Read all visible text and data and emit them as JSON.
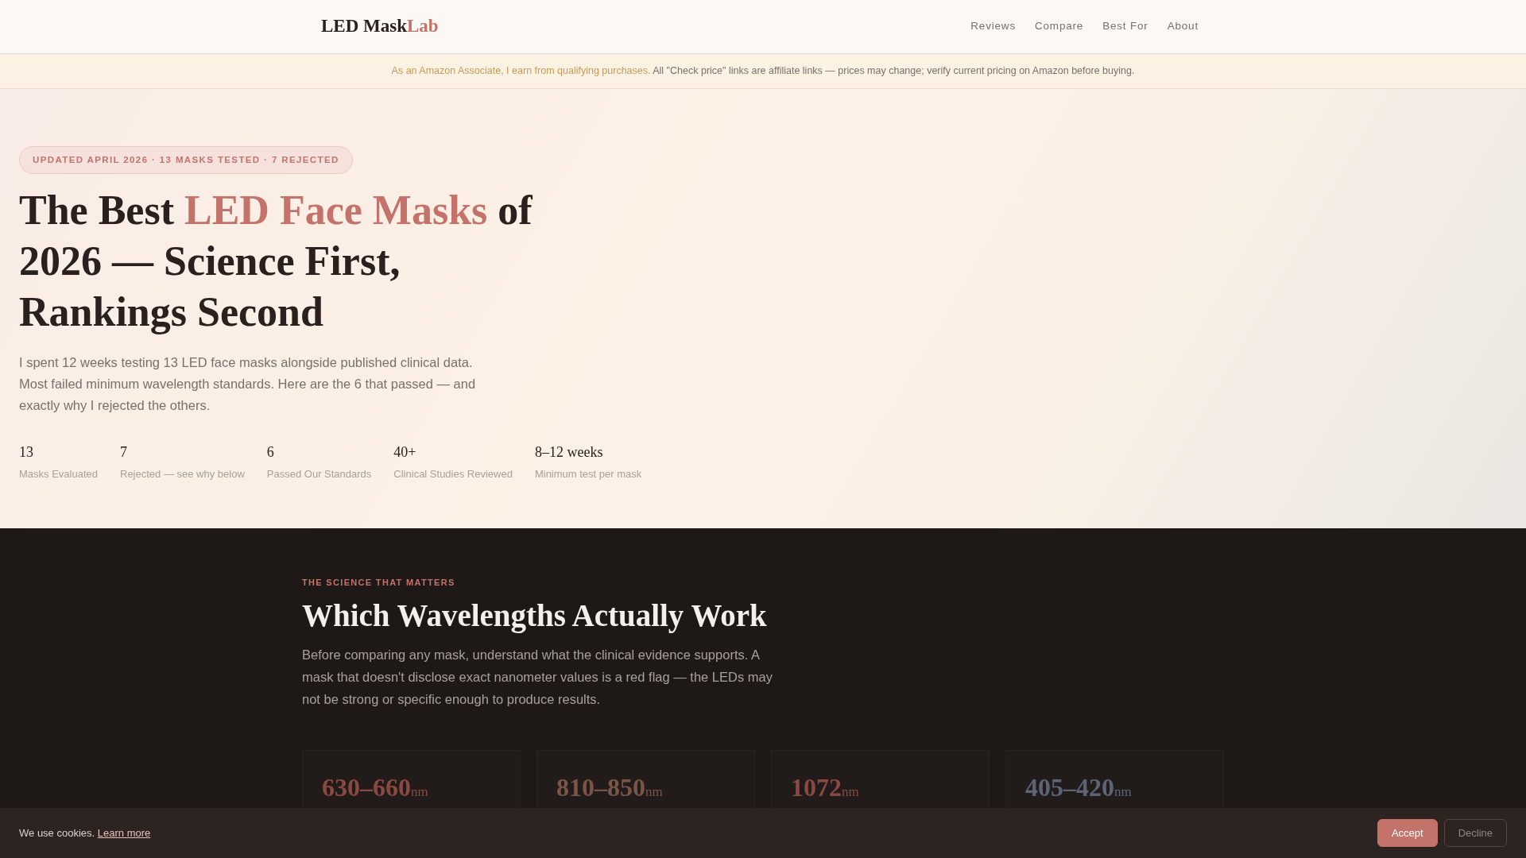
{
  "header": {
    "logo": [
      {
        "text": "LED Mask",
        "accent": false
      },
      {
        "text": "Lab",
        "accent": true
      }
    ],
    "nav": [
      "Reviews",
      "Compare",
      "Best For",
      "About"
    ]
  },
  "disclosure": [
    {
      "text": "As an Amazon Associate, I earn from qualifying purchases.",
      "accent": true
    },
    {
      "text": " All \"Check price\" links are affiliate links — prices may change; verify current pricing on Amazon before buying.",
      "accent": false
    }
  ],
  "hero": {
    "badge": "UPDATED APRIL 2026 · 13 MASKS TESTED · 7 REJECTED",
    "title": [
      {
        "text": "The Best ",
        "accent": false
      },
      {
        "text": "LED Face Masks",
        "accent": true
      },
      {
        "text": " of 2026 — Science First, Rankings Second",
        "accent": false
      }
    ],
    "intro": "I spent 12 weeks testing 13 LED face masks alongside published clinical data. Most failed minimum wavelength standards. Here are the 6 that passed — and exactly why I rejected the others.",
    "stats": [
      {
        "value": "13",
        "label": "Masks Evaluated"
      },
      {
        "value": "7",
        "label": "Rejected — see why below"
      },
      {
        "value": "6",
        "label": "Passed Our Standards"
      },
      {
        "value": "40+",
        "label": "Clinical Studies Reviewed"
      },
      {
        "value": "8–12 weeks",
        "label": "Minimum test per mask"
      }
    ]
  },
  "science": {
    "eyebrow": "THE SCIENCE THAT MATTERS",
    "heading": "Which Wavelengths Actually Work",
    "text": "Before comparing any mask, understand what the clinical evidence supports. A mask that doesn't disclose exact nanometer values is a red flag — the LEDs may not be strong or specific enough to produce results.",
    "cards": [
      {
        "range": "630–660",
        "unit": "nm",
        "color": "#8a4a42"
      },
      {
        "range": "810–850",
        "unit": "nm",
        "color": "#7a5548"
      },
      {
        "range": "1072",
        "unit": "nm",
        "color": "#8a4a42"
      },
      {
        "range": "405–420",
        "unit": "nm",
        "color": "#5e6478"
      }
    ]
  },
  "cookie": {
    "text": "We use cookies.",
    "link": "Learn more",
    "buttons": [
      {
        "label": "Accept",
        "primary": true
      },
      {
        "label": "Decline",
        "primary": false
      }
    ]
  }
}
